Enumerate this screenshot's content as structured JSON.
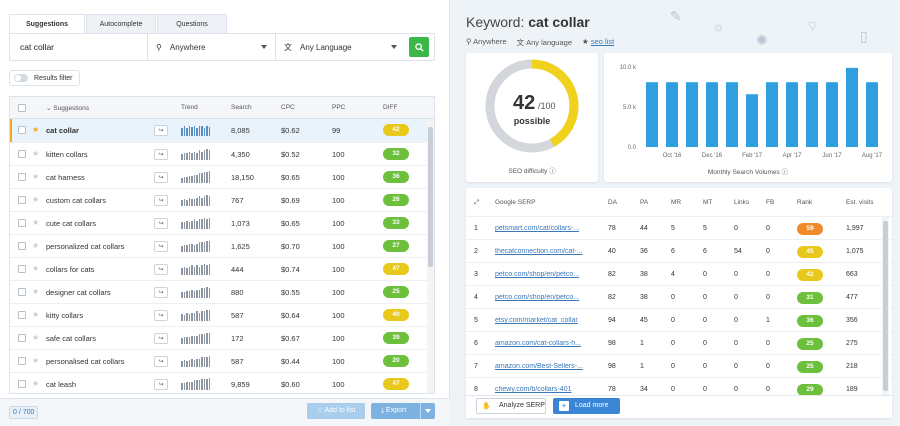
{
  "tabs": [
    "Suggestions",
    "Autocomplete",
    "Questions"
  ],
  "search": {
    "keyword": "cat collar",
    "location": "Anywhere",
    "language": "Any Language"
  },
  "filter_label": "Results filter",
  "table": {
    "headers": {
      "suggestions": "Suggestions",
      "trend": "Trend",
      "search": "Search",
      "cpc": "CPC",
      "ppc": "PPC",
      "diff": "DIFF"
    },
    "rows": [
      {
        "kw": "cat collar",
        "search": "8,085",
        "cpc": "$0.62",
        "ppc": "99",
        "diff": "42",
        "color": "#e8c81a",
        "trend": [
          0.7,
          0.8,
          0.7,
          0.8,
          0.75,
          0.8,
          0.7,
          0.8,
          0.8,
          0.7,
          0.8,
          0.75
        ]
      },
      {
        "kw": "kitten collars",
        "search": "4,350",
        "cpc": "$0.52",
        "ppc": "100",
        "diff": "32",
        "color": "#6cc03c",
        "trend": [
          0.5,
          0.6,
          0.6,
          0.7,
          0.6,
          0.7,
          0.6,
          0.8,
          0.7,
          0.8,
          0.9,
          0.8
        ]
      },
      {
        "kw": "cat harness",
        "search": "18,150",
        "cpc": "$0.65",
        "ppc": "100",
        "diff": "36",
        "color": "#6cc03c",
        "trend": [
          0.4,
          0.5,
          0.5,
          0.6,
          0.6,
          0.7,
          0.7,
          0.8,
          0.8,
          0.9,
          0.9,
          1
        ]
      },
      {
        "kw": "custom cat collars",
        "search": "767",
        "cpc": "$0.69",
        "ppc": "100",
        "diff": "26",
        "color": "#6cc03c",
        "trend": [
          0.5,
          0.6,
          0.5,
          0.7,
          0.6,
          0.6,
          0.7,
          0.8,
          0.7,
          0.8,
          0.9,
          0.8
        ]
      },
      {
        "kw": "cute cat collars",
        "search": "1,073",
        "cpc": "$0.65",
        "ppc": "100",
        "diff": "33",
        "color": "#6cc03c",
        "trend": [
          0.6,
          0.6,
          0.7,
          0.6,
          0.7,
          0.8,
          0.7,
          0.8,
          0.8,
          0.9,
          0.8,
          0.9
        ]
      },
      {
        "kw": "personalized cat collars",
        "search": "1,625",
        "cpc": "$0.70",
        "ppc": "100",
        "diff": "27",
        "color": "#6cc03c",
        "trend": [
          0.5,
          0.6,
          0.6,
          0.7,
          0.7,
          0.6,
          0.7,
          0.8,
          0.8,
          0.8,
          0.9,
          0.9
        ]
      },
      {
        "kw": "collars for cats",
        "search": "444",
        "cpc": "$0.74",
        "ppc": "100",
        "diff": "47",
        "color": "#e8c81a",
        "trend": [
          0.6,
          0.7,
          0.6,
          0.7,
          0.8,
          0.7,
          0.8,
          0.7,
          0.8,
          0.9,
          0.8,
          0.9
        ]
      },
      {
        "kw": "designer cat collars",
        "search": "880",
        "cpc": "$0.55",
        "ppc": "100",
        "diff": "25",
        "color": "#6cc03c",
        "trend": [
          0.5,
          0.5,
          0.6,
          0.6,
          0.7,
          0.6,
          0.7,
          0.7,
          0.8,
          0.8,
          0.9,
          0.8
        ]
      },
      {
        "kw": "kitty collars",
        "search": "587",
        "cpc": "$0.64",
        "ppc": "100",
        "diff": "40",
        "color": "#e8c81a",
        "trend": [
          0.6,
          0.5,
          0.7,
          0.6,
          0.7,
          0.7,
          0.8,
          0.7,
          0.8,
          0.8,
          0.9,
          0.9
        ]
      },
      {
        "kw": "safe cat collars",
        "search": "172",
        "cpc": "$0.67",
        "ppc": "100",
        "diff": "39",
        "color": "#6cc03c",
        "trend": [
          0.5,
          0.6,
          0.6,
          0.6,
          0.7,
          0.7,
          0.7,
          0.8,
          0.8,
          0.8,
          0.9,
          0.9
        ]
      },
      {
        "kw": "personalised cat collars",
        "search": "587",
        "cpc": "$0.44",
        "ppc": "100",
        "diff": "20",
        "color": "#6cc03c",
        "trend": [
          0.5,
          0.6,
          0.5,
          0.6,
          0.7,
          0.6,
          0.7,
          0.7,
          0.8,
          0.8,
          0.8,
          0.9
        ]
      },
      {
        "kw": "cat leash",
        "search": "9,859",
        "cpc": "$0.60",
        "ppc": "100",
        "diff": "47",
        "color": "#e8c81a",
        "trend": [
          0.6,
          0.6,
          0.7,
          0.7,
          0.7,
          0.8,
          0.8,
          0.8,
          0.9,
          0.9,
          0.9,
          1
        ]
      }
    ]
  },
  "footer": {
    "count": "0 / 700",
    "add_label": "Add to list",
    "export_label": "Export"
  },
  "detail": {
    "prefix": "Keyword:",
    "keyword": "cat collar",
    "location": "Anywhere",
    "language": "Any language",
    "serp_link": "seo list",
    "seo_value": "42",
    "seo_max": "/100",
    "seo_word": "possible",
    "seo_label": "SEO difficulty",
    "seo_color": "#f0d21c",
    "vol_label": "Monthly Search Volumes"
  },
  "chart_data": {
    "type": "bar",
    "categories": [
      "Sep '16",
      "Oct '16",
      "Nov '16",
      "Dec '16",
      "Jan '17",
      "Feb '17",
      "Mar '17",
      "Apr '17",
      "May '17",
      "Jun '17",
      "Jul '17",
      "Aug '17"
    ],
    "x_tick_labels": [
      "Oct '16",
      "Dec '16",
      "Feb '17",
      "Apr '17",
      "Jun '17",
      "Aug '17"
    ],
    "values": [
      8100,
      8100,
      8100,
      8100,
      8100,
      6600,
      8100,
      8100,
      8100,
      8100,
      9900,
      8100
    ],
    "yticks": [
      "0.0",
      "5.0 k",
      "10.0 k"
    ],
    "ylim": [
      0,
      10000
    ],
    "color": "#2f9fe0",
    "xlabel": "Monthly Search Volumes"
  },
  "serp": {
    "headers": {
      "url": "Google SERP",
      "da": "DA",
      "pa": "PA",
      "mr": "MR",
      "mt": "MT",
      "links": "Links",
      "fb": "FB",
      "rank": "Rank",
      "visits": "Est. visits"
    },
    "rows": [
      {
        "n": "1",
        "url": "petsmart.com/cat/collars-...",
        "da": "78",
        "pa": "44",
        "mr": "5",
        "mt": "5",
        "links": "0",
        "fb": "0",
        "rank": "59",
        "rc": "#f08a2c",
        "visits": "1,997"
      },
      {
        "n": "2",
        "url": "thecatconnection.com/cat-...",
        "da": "40",
        "pa": "36",
        "mr": "6",
        "mt": "6",
        "links": "54",
        "fb": "0",
        "rank": "45",
        "rc": "#e8c81a",
        "visits": "1,075"
      },
      {
        "n": "3",
        "url": "petco.com/shop/en/petco...",
        "da": "82",
        "pa": "38",
        "mr": "4",
        "mt": "0",
        "links": "0",
        "fb": "0",
        "rank": "42",
        "rc": "#e8c81a",
        "visits": "663"
      },
      {
        "n": "4",
        "url": "petco.com/shop/en/petco...",
        "da": "82",
        "pa": "38",
        "mr": "0",
        "mt": "0",
        "links": "0",
        "fb": "0",
        "rank": "31",
        "rc": "#6cc03c",
        "visits": "477"
      },
      {
        "n": "5",
        "url": "etsy.com/market/cat_collar",
        "da": "94",
        "pa": "45",
        "mr": "0",
        "mt": "0",
        "links": "0",
        "fb": "1",
        "rank": "36",
        "rc": "#6cc03c",
        "visits": "356"
      },
      {
        "n": "6",
        "url": "amazon.com/cat-collars-h...",
        "da": "98",
        "pa": "1",
        "mr": "0",
        "mt": "0",
        "links": "0",
        "fb": "0",
        "rank": "25",
        "rc": "#6cc03c",
        "visits": "275"
      },
      {
        "n": "7",
        "url": "amazon.com/Best-Sellers-...",
        "da": "98",
        "pa": "1",
        "mr": "0",
        "mt": "0",
        "links": "0",
        "fb": "0",
        "rank": "25",
        "rc": "#6cc03c",
        "visits": "218"
      },
      {
        "n": "8",
        "url": "chewy.com/b/collars-401",
        "da": "78",
        "pa": "34",
        "mr": "0",
        "mt": "0",
        "links": "0",
        "fb": "0",
        "rank": "29",
        "rc": "#6cc03c",
        "visits": "189"
      }
    ],
    "analyze_label": "Analyze SERP",
    "load_label": "Load more"
  }
}
